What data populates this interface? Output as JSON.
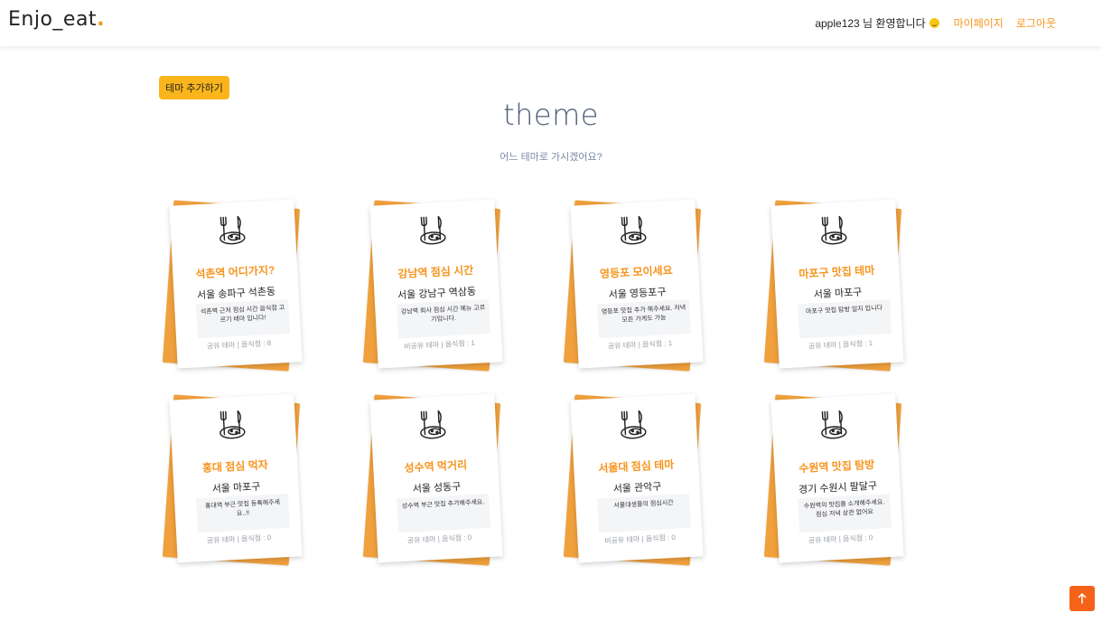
{
  "header": {
    "logo_text": "Enjo_eat",
    "logo_dot": ".",
    "welcome": "apple123 님 환영합니다",
    "welcome_emoji": "grinning-face",
    "mypage_label": "마이페이지",
    "logout_label": "로그아웃",
    "accent_color": "#f7941d"
  },
  "main": {
    "add_theme_label": "테마 추가하기",
    "title": "theme",
    "subtitle": "어느 테마로 가시겠어요?"
  },
  "cards": [
    {
      "title": "석촌역 어디가지?",
      "location": "서울 송파구 석촌동",
      "description": "석촌역 근처 점심 시간 음식점 고르기 테마 입니다!",
      "visibility": "공유 테마",
      "count": "음식점 : 8",
      "icon": "fork-knife-plate-icon"
    },
    {
      "title": "강남역 점심 시간",
      "location": "서울 강남구 역삼동",
      "description": "강남역 회사 점심 시간 메뉴 고르기입니다.",
      "visibility": "비공유 테마",
      "count": "음식점 : 1",
      "icon": "fork-knife-plate-icon"
    },
    {
      "title": "영등포 모이세요",
      "location": "서울 영등포구",
      "description": "영등포 맛집 추가 해주세요. 저녁 모든 가게도 가능",
      "visibility": "공유 테마",
      "count": "음식점 : 1",
      "icon": "fork-knife-plate-icon"
    },
    {
      "title": "마포구 맛집 테마",
      "location": "서울 마포구",
      "description": "마포구 맛집 탐방 일지 입니다",
      "visibility": "공유 테마",
      "count": "음식점 : 1",
      "icon": "fork-knife-plate-icon"
    },
    {
      "title": "홍대 점심 먹자",
      "location": "서울 마포구",
      "description": "홍대역 부근 맛집 등록해주세요..!!",
      "visibility": "공유 테마",
      "count": "음식점 : 0",
      "icon": "fork-knife-plate-icon"
    },
    {
      "title": "성수역 먹거리",
      "location": "서울 성동구",
      "description": "성수역 부근 맛집 추가해주세요.",
      "visibility": "공유 테마",
      "count": "음식점 : 0",
      "icon": "fork-knife-plate-icon"
    },
    {
      "title": "서울대 점심 테마",
      "location": "서울 관악구",
      "description": "서울대생들의 점심시간",
      "visibility": "비공유 테마",
      "count": "음식점 : 0",
      "icon": "fork-knife-plate-icon"
    },
    {
      "title": "수원역 맛집 탐방",
      "location": "경기 수원시 팔달구",
      "description": "수원역의 맛집을 소개해주세요. 점심 저녁 상관 없어요",
      "visibility": "공유 테마",
      "count": "음식점 : 0",
      "icon": "fork-knife-plate-icon"
    }
  ],
  "scroll_top": {
    "icon": "arrow-up-icon",
    "color": "#f5631a"
  }
}
